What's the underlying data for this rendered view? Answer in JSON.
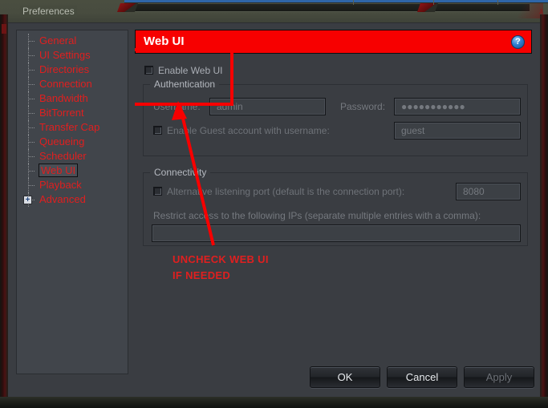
{
  "window": {
    "title": "Preferences",
    "logo_glyph": "»"
  },
  "sidebar": {
    "items": [
      {
        "label": "General",
        "selected": false,
        "expandable": false
      },
      {
        "label": "UI Settings",
        "selected": false,
        "expandable": false
      },
      {
        "label": "Directories",
        "selected": false,
        "expandable": false
      },
      {
        "label": "Connection",
        "selected": false,
        "expandable": false
      },
      {
        "label": "Bandwidth",
        "selected": false,
        "expandable": false
      },
      {
        "label": "BitTorrent",
        "selected": false,
        "expandable": false
      },
      {
        "label": "Transfer Cap",
        "selected": false,
        "expandable": false
      },
      {
        "label": "Queueing",
        "selected": false,
        "expandable": false
      },
      {
        "label": "Scheduler",
        "selected": false,
        "expandable": false
      },
      {
        "label": "Web UI",
        "selected": true,
        "expandable": false
      },
      {
        "label": "Playback",
        "selected": false,
        "expandable": false
      },
      {
        "label": "Advanced",
        "selected": false,
        "expandable": true,
        "expander_glyph": "+"
      }
    ]
  },
  "page": {
    "header_title": "Web UI",
    "help_label": "?",
    "enable_webui_label": "Enable Web UI",
    "enable_webui_checked": false,
    "authentication": {
      "group_title": "Authentication",
      "username_label": "Username:",
      "username_value": "admin",
      "password_label": "Password:",
      "password_value": "●●●●●●●●●●●",
      "guest_label": "Enable Guest account with username:",
      "guest_checked": false,
      "guest_value": "guest"
    },
    "connectivity": {
      "group_title": "Connectivity",
      "alt_port_label": "Alternative listening port (default is the connection port):",
      "alt_port_checked": false,
      "alt_port_value": "8080",
      "restrict_label": "Restrict access to the following IPs (separate multiple entries with a comma):",
      "restrict_value": ""
    }
  },
  "buttons": {
    "ok": "OK",
    "cancel": "Cancel",
    "apply": "Apply"
  },
  "annotations": {
    "line1": "UNCHECK WEB UI",
    "line2": "IF NEEDED",
    "color": "#e01f1f"
  }
}
